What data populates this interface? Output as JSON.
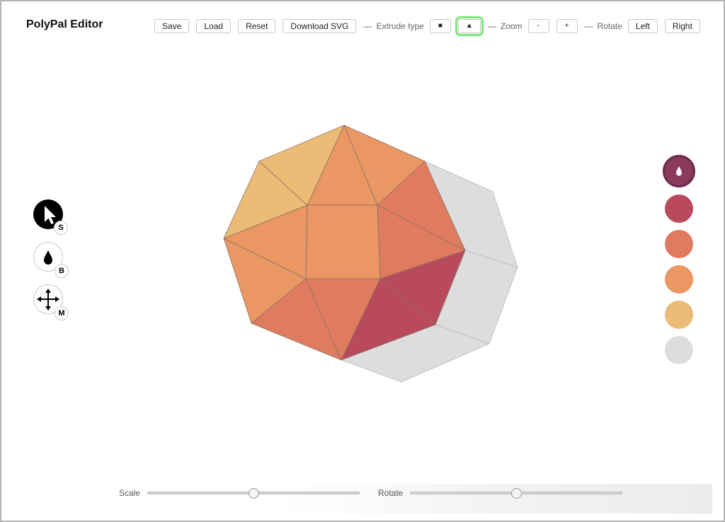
{
  "app": {
    "title": "PolyPal Editor"
  },
  "toolbar": {
    "save": "Save",
    "load": "Load",
    "reset": "Reset",
    "download_svg": "Download SVG",
    "separator": "—",
    "extrude_label": "Extrude type",
    "extrude_square_glyph": "■",
    "extrude_triangle_glyph": "▲",
    "extrude_selected": "triangle",
    "zoom_label": "Zoom",
    "zoom_out": "-",
    "zoom_in": "+",
    "rotate_label": "Rotate",
    "rotate_left": "Left",
    "rotate_right": "Right"
  },
  "tools": [
    {
      "name": "select",
      "icon": "cursor-icon",
      "hotkey": "S",
      "selected": true
    },
    {
      "name": "bucket",
      "icon": "droplet-icon",
      "hotkey": "B",
      "selected": false
    },
    {
      "name": "move",
      "icon": "move-arrows-icon",
      "hotkey": "M",
      "selected": false
    }
  ],
  "palette": {
    "active_color": "#8c3a5c",
    "active_icon": "droplet-icon",
    "swatches": [
      "#b94a5b",
      "#df7c5f",
      "#ea9763",
      "#ecbc77",
      "#dddddd"
    ]
  },
  "sliders": {
    "scale_label": "Scale",
    "scale_value": 0.5,
    "rotate_label": "Rotate",
    "rotate_value": 0.5
  },
  "colors": {
    "red": "#b94a5b",
    "coral": "#df7c5f",
    "orange": "#ea9763",
    "yellow": "#ecbc77",
    "gray": "#dddddd",
    "stroke": "#8a7060"
  }
}
